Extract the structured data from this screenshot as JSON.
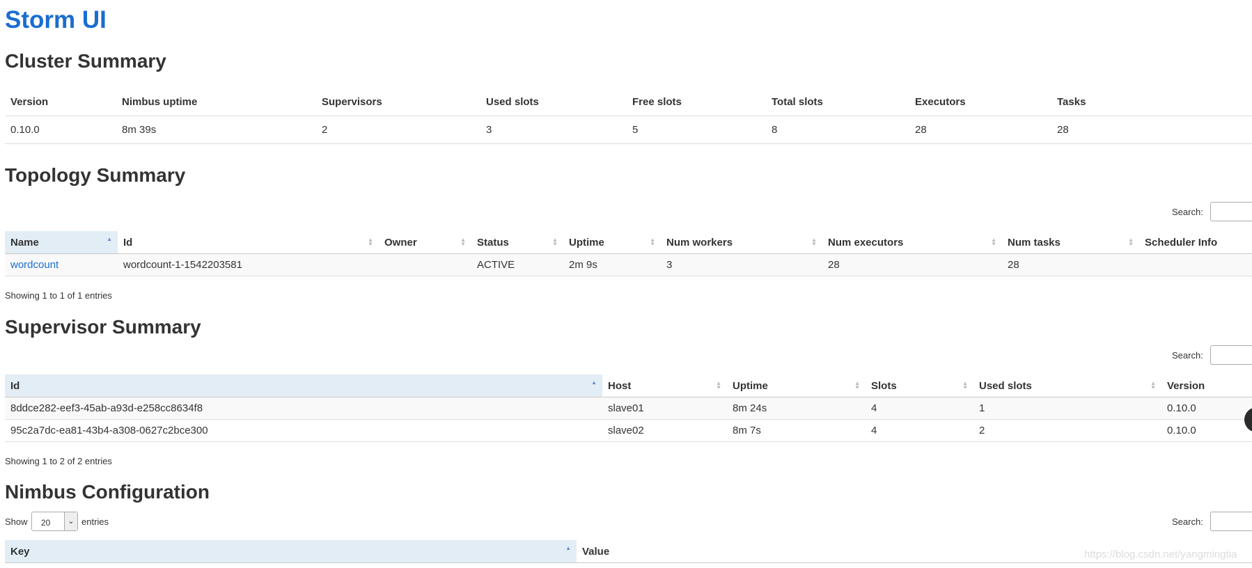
{
  "app_title": "Storm UI",
  "cluster": {
    "heading": "Cluster Summary",
    "columns": [
      "Version",
      "Nimbus uptime",
      "Supervisors",
      "Used slots",
      "Free slots",
      "Total slots",
      "Executors",
      "Tasks"
    ],
    "rows": [
      [
        "0.10.0",
        "8m 39s",
        "2",
        "3",
        "5",
        "8",
        "28",
        "28"
      ]
    ]
  },
  "topology": {
    "heading": "Topology Summary",
    "search_label": "Search:",
    "columns": [
      "Name",
      "Id",
      "Owner",
      "Status",
      "Uptime",
      "Num workers",
      "Num executors",
      "Num tasks",
      "Scheduler Info"
    ],
    "rows": [
      [
        "wordcount",
        "wordcount-1-1542203581",
        "",
        "ACTIVE",
        "2m 9s",
        "3",
        "28",
        "28",
        ""
      ]
    ],
    "info": "Showing 1 to 1 of 1 entries"
  },
  "supervisor": {
    "heading": "Supervisor Summary",
    "search_label": "Search:",
    "columns": [
      "Id",
      "Host",
      "Uptime",
      "Slots",
      "Used slots",
      "Version"
    ],
    "rows": [
      [
        "8ddce282-eef3-45ab-a93d-e258cc8634f8",
        "slave01",
        "8m 24s",
        "4",
        "1",
        "0.10.0"
      ],
      [
        "95c2a7dc-ea81-43b4-a308-0627c2bce300",
        "slave02",
        "8m 7s",
        "4",
        "2",
        "0.10.0"
      ]
    ],
    "info": "Showing 1 to 2 of 2 entries"
  },
  "nimbus_config": {
    "heading": "Nimbus Configuration",
    "show_label": "Show",
    "page_size": "20",
    "entries_label": "entries",
    "search_label": "Search:",
    "columns": [
      "Key",
      "Value"
    ]
  },
  "watermark": "https://blog.csdn.net/yangmingtia"
}
